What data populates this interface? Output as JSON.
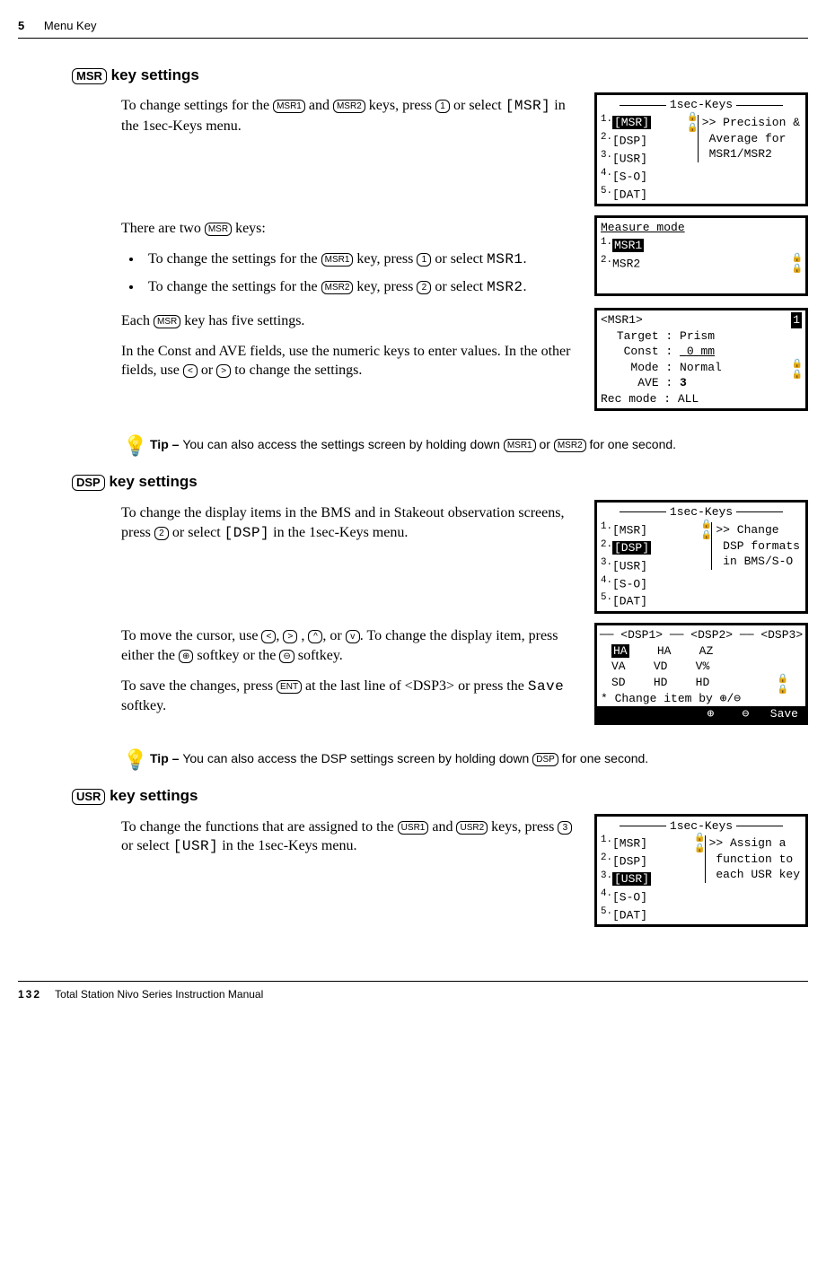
{
  "header": {
    "chapter_num": "5",
    "chapter_title": "Menu Key"
  },
  "keys": {
    "msr": "MSR",
    "msr1": "MSR1",
    "msr2": "MSR2",
    "dsp": "DSP",
    "usr": "USR",
    "usr1": "USR1",
    "usr2": "USR2",
    "ent": "ENT",
    "k1": "1",
    "k2": "2",
    "k3": "3",
    "left": "<",
    "right": ">",
    "up": "^",
    "down": "v",
    "softL": "⊕",
    "softR": "⊖"
  },
  "sec1": {
    "heading_suffix": " key settings",
    "p1a": "To change settings for the ",
    "p1b": " and ",
    "p1c": " keys, press ",
    "p1d": " or select ",
    "p1e": " in the 1sec-Keys menu.",
    "code1": "[MSR]",
    "p2a": "There are two ",
    "p2b": " keys:",
    "li1a": "To change the settings for the ",
    "li1b": " key, press ",
    "li1c": " or select ",
    "li1d": ".",
    "li1code": "MSR1",
    "li2code": "MSR2",
    "p3a": "Each ",
    "p3b": " key has five settings.",
    "p4": "In the Const and AVE fields, use the numeric keys to enter values. In the other fields, use ",
    "p4b": " or ",
    "p4c": " to change the settings."
  },
  "tip1": {
    "label": "Tip – ",
    "text_a": "You can also access the settings screen by holding down ",
    "text_b": " or ",
    "text_c": " for one second."
  },
  "sec2": {
    "heading_suffix": " key settings",
    "p1a": "To change the display items in the BMS and in Stakeout observation screens, press ",
    "p1b": " or select ",
    "p1c": " in the 1sec-Keys menu.",
    "code1": "[DSP]",
    "p2a": "To move the cursor, use ",
    "p2b": ", ",
    "p2c": " , ",
    "p2d": ", or ",
    "p2e": ". To change the display item, press either the ",
    "p2f": " softkey or the ",
    "p2g": " softkey.",
    "p3a": "To save the changes, press ",
    "p3b": " at the last line of <DSP3> or press the ",
    "p3c": " softkey.",
    "code2": "Save"
  },
  "tip2": {
    "label": "Tip – ",
    "text_a": "You can also access the DSP settings screen by holding down ",
    "text_b": " for one second."
  },
  "sec3": {
    "heading_suffix": " key settings",
    "p1a": "To change the functions that are assigned to the ",
    "p1b": " and ",
    "p1c": " keys, press ",
    "p1d": " or select ",
    "p1e": " in the 1sec-Keys menu.",
    "code1": "[USR]"
  },
  "screens": {
    "s1": {
      "title": "1sec-Keys",
      "items": [
        "[MSR]",
        "[DSP]",
        "[USR]",
        "[S-O]",
        "[DAT]"
      ],
      "hint1": ">> Precision &",
      "hint2": "Average for",
      "hint3": "MSR1/MSR2",
      "sel": 0
    },
    "s2": {
      "title": "Measure mode",
      "items": [
        "MSR1",
        "MSR2"
      ],
      "sel": 0
    },
    "s3": {
      "title": "<MSR1>",
      "rows": [
        {
          "l": "Target",
          "v": "Prism"
        },
        {
          "l": "Const",
          "v": "0   mm"
        },
        {
          "l": "Mode",
          "v": "Normal"
        },
        {
          "l": "AVE",
          "v": "3"
        },
        {
          "l": "Rec mode",
          "v": "ALL"
        }
      ],
      "page": "1"
    },
    "s4": {
      "title": "1sec-Keys",
      "items": [
        "[MSR]",
        "[DSP]",
        "[USR]",
        "[S-O]",
        "[DAT]"
      ],
      "hint1": ">> Change",
      "hint2": "DSP formats",
      "hint3": "in BMS/S-O",
      "sel": 1
    },
    "s5": {
      "h1": "<DSP1>",
      "h2": "<DSP2>",
      "h3": "<DSP3>",
      "r1": [
        "HA",
        "HA",
        "AZ"
      ],
      "r2": [
        "VA",
        "VD",
        "V%"
      ],
      "r3": [
        "SD",
        "HD",
        "HD"
      ],
      "note": "* Change item by ⊕/⊖",
      "sk1": "⊕",
      "sk2": "⊖",
      "sk3": "Save"
    },
    "s6": {
      "title": "1sec-Keys",
      "items": [
        "[MSR]",
        "[DSP]",
        "[USR]",
        "[S-O]",
        "[DAT]"
      ],
      "hint1": ">> Assign a",
      "hint2": "function to",
      "hint3": "each USR key",
      "sel": 2
    }
  },
  "footer": {
    "page": "132",
    "title": "Total Station Nivo Series Instruction Manual"
  }
}
